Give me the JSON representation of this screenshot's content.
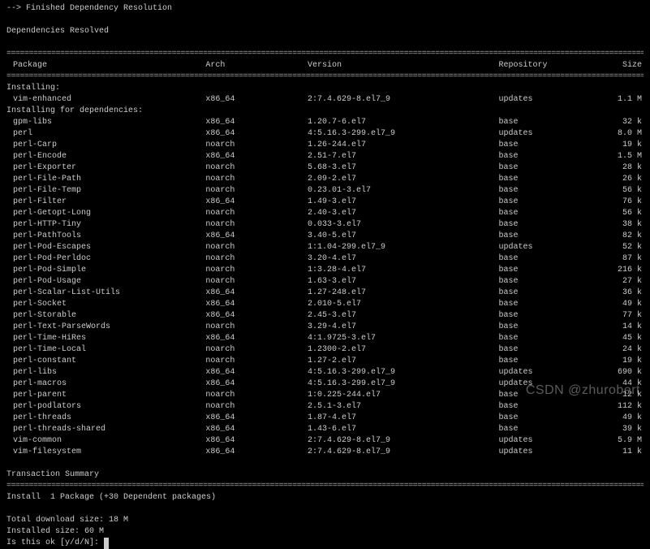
{
  "header": {
    "finished": "--> Finished Dependency Resolution",
    "resolved": "Dependencies Resolved"
  },
  "columns": {
    "package": "Package",
    "arch": "Arch",
    "version": "Version",
    "repository": "Repository",
    "size": "Size"
  },
  "sections": {
    "installing": "Installing:",
    "installing_deps": "Installing for dependencies:",
    "trans_summary": "Transaction Summary",
    "install_line": "Install  1 Package (+30 Dependent packages)",
    "total_dl": "Total download size: 18 M",
    "installed_size": "Installed size: 60 M",
    "prompt": "Is this ok [y/d/N]: "
  },
  "main_pkg": {
    "name": "vim-enhanced",
    "arch": "x86_64",
    "version": "2:7.4.629-8.el7_9",
    "repo": "updates",
    "size": "1.1 M"
  },
  "deps": [
    {
      "name": "gpm-libs",
      "arch": "x86_64",
      "version": "1.20.7-6.el7",
      "repo": "base",
      "size": "32 k"
    },
    {
      "name": "perl",
      "arch": "x86_64",
      "version": "4:5.16.3-299.el7_9",
      "repo": "updates",
      "size": "8.0 M"
    },
    {
      "name": "perl-Carp",
      "arch": "noarch",
      "version": "1.26-244.el7",
      "repo": "base",
      "size": "19 k"
    },
    {
      "name": "perl-Encode",
      "arch": "x86_64",
      "version": "2.51-7.el7",
      "repo": "base",
      "size": "1.5 M"
    },
    {
      "name": "perl-Exporter",
      "arch": "noarch",
      "version": "5.68-3.el7",
      "repo": "base",
      "size": "28 k"
    },
    {
      "name": "perl-File-Path",
      "arch": "noarch",
      "version": "2.09-2.el7",
      "repo": "base",
      "size": "26 k"
    },
    {
      "name": "perl-File-Temp",
      "arch": "noarch",
      "version": "0.23.01-3.el7",
      "repo": "base",
      "size": "56 k"
    },
    {
      "name": "perl-Filter",
      "arch": "x86_64",
      "version": "1.49-3.el7",
      "repo": "base",
      "size": "76 k"
    },
    {
      "name": "perl-Getopt-Long",
      "arch": "noarch",
      "version": "2.40-3.el7",
      "repo": "base",
      "size": "56 k"
    },
    {
      "name": "perl-HTTP-Tiny",
      "arch": "noarch",
      "version": "0.033-3.el7",
      "repo": "base",
      "size": "38 k"
    },
    {
      "name": "perl-PathTools",
      "arch": "x86_64",
      "version": "3.40-5.el7",
      "repo": "base",
      "size": "82 k"
    },
    {
      "name": "perl-Pod-Escapes",
      "arch": "noarch",
      "version": "1:1.04-299.el7_9",
      "repo": "updates",
      "size": "52 k"
    },
    {
      "name": "perl-Pod-Perldoc",
      "arch": "noarch",
      "version": "3.20-4.el7",
      "repo": "base",
      "size": "87 k"
    },
    {
      "name": "perl-Pod-Simple",
      "arch": "noarch",
      "version": "1:3.28-4.el7",
      "repo": "base",
      "size": "216 k"
    },
    {
      "name": "perl-Pod-Usage",
      "arch": "noarch",
      "version": "1.63-3.el7",
      "repo": "base",
      "size": "27 k"
    },
    {
      "name": "perl-Scalar-List-Utils",
      "arch": "x86_64",
      "version": "1.27-248.el7",
      "repo": "base",
      "size": "36 k"
    },
    {
      "name": "perl-Socket",
      "arch": "x86_64",
      "version": "2.010-5.el7",
      "repo": "base",
      "size": "49 k"
    },
    {
      "name": "perl-Storable",
      "arch": "x86_64",
      "version": "2.45-3.el7",
      "repo": "base",
      "size": "77 k"
    },
    {
      "name": "perl-Text-ParseWords",
      "arch": "noarch",
      "version": "3.29-4.el7",
      "repo": "base",
      "size": "14 k"
    },
    {
      "name": "perl-Time-HiRes",
      "arch": "x86_64",
      "version": "4:1.9725-3.el7",
      "repo": "base",
      "size": "45 k"
    },
    {
      "name": "perl-Time-Local",
      "arch": "noarch",
      "version": "1.2300-2.el7",
      "repo": "base",
      "size": "24 k"
    },
    {
      "name": "perl-constant",
      "arch": "noarch",
      "version": "1.27-2.el7",
      "repo": "base",
      "size": "19 k"
    },
    {
      "name": "perl-libs",
      "arch": "x86_64",
      "version": "4:5.16.3-299.el7_9",
      "repo": "updates",
      "size": "690 k"
    },
    {
      "name": "perl-macros",
      "arch": "x86_64",
      "version": "4:5.16.3-299.el7_9",
      "repo": "updates",
      "size": "44 k"
    },
    {
      "name": "perl-parent",
      "arch": "noarch",
      "version": "1:0.225-244.el7",
      "repo": "base",
      "size": "12 k"
    },
    {
      "name": "perl-podlators",
      "arch": "noarch",
      "version": "2.5.1-3.el7",
      "repo": "base",
      "size": "112 k"
    },
    {
      "name": "perl-threads",
      "arch": "x86_64",
      "version": "1.87-4.el7",
      "repo": "base",
      "size": "49 k"
    },
    {
      "name": "perl-threads-shared",
      "arch": "x86_64",
      "version": "1.43-6.el7",
      "repo": "base",
      "size": "39 k"
    },
    {
      "name": "vim-common",
      "arch": "x86_64",
      "version": "2:7.4.629-8.el7_9",
      "repo": "updates",
      "size": "5.9 M"
    },
    {
      "name": "vim-filesystem",
      "arch": "x86_64",
      "version": "2:7.4.629-8.el7_9",
      "repo": "updates",
      "size": "11 k"
    }
  ],
  "watermark": "CSDN @zhurobert"
}
